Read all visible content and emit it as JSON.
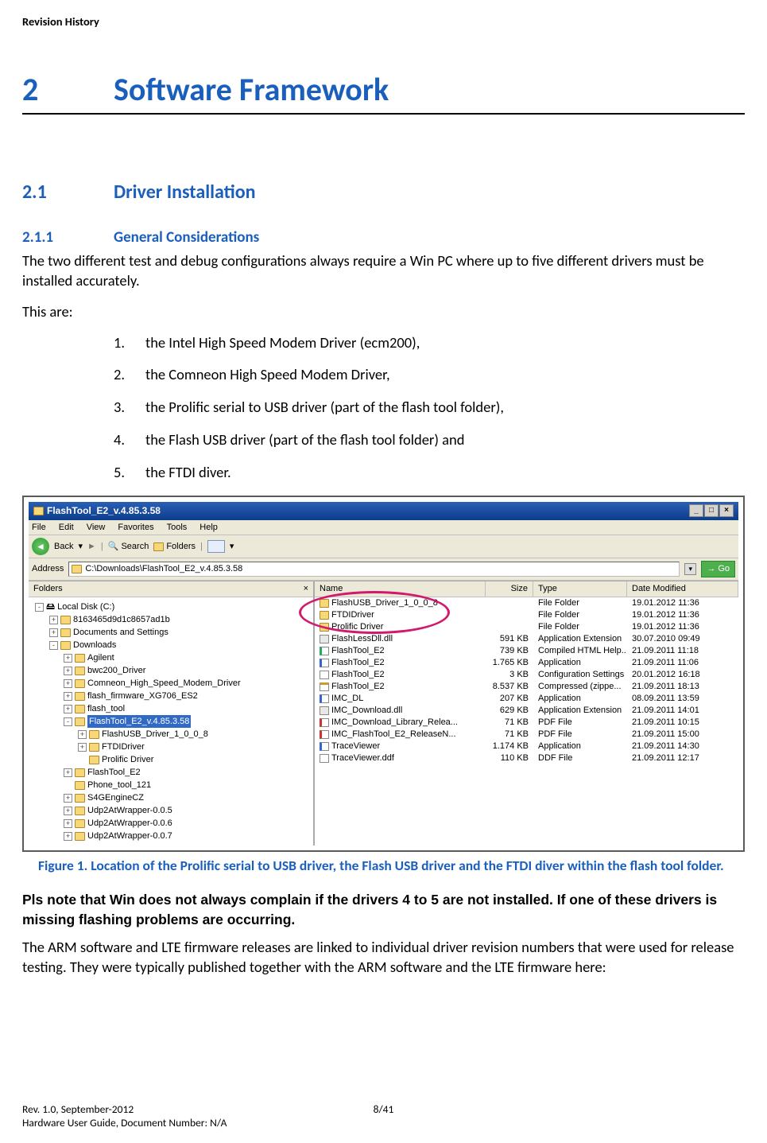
{
  "header": "Revision History",
  "chapter": {
    "num": "2",
    "title": "Software Framework"
  },
  "section": {
    "num": "2.1",
    "title": "Driver Installation"
  },
  "subsection": {
    "num": "2.1.1",
    "title": "General Considerations"
  },
  "para1": "The two different test and debug configurations always require a Win PC where up to five different drivers must be installed accurately.",
  "para2": "This are:",
  "drivers": [
    "the Intel High Speed Modem Driver (ecm200),",
    "the Comneon High Speed Modem Driver,",
    "the Prolific serial to USB driver (part of the flash tool folder),",
    "the Flash USB driver (part of the flash tool folder) and",
    "the FTDI diver."
  ],
  "explorer": {
    "title": "FlashTool_E2_v.4.85.3.58",
    "menu": [
      "File",
      "Edit",
      "View",
      "Favorites",
      "Tools",
      "Help"
    ],
    "toolbar": {
      "back": "Back",
      "search": "Search",
      "folders": "Folders"
    },
    "address_label": "Address",
    "address_path": "C:\\Downloads\\FlashTool_E2_v.4.85.3.58",
    "go": "Go",
    "folders_pane_title": "Folders",
    "tree": {
      "root": "Local Disk (C:)",
      "items": [
        {
          "level": 1,
          "exp": "+",
          "label": "8163465d9d1c8657ad1b"
        },
        {
          "level": 1,
          "exp": "+",
          "label": "Documents and Settings"
        },
        {
          "level": 1,
          "exp": "-",
          "label": "Downloads"
        },
        {
          "level": 2,
          "exp": "+",
          "label": "Agilent"
        },
        {
          "level": 2,
          "exp": "+",
          "label": "bwc200_Driver"
        },
        {
          "level": 2,
          "exp": "+",
          "label": "Comneon_High_Speed_Modem_Driver"
        },
        {
          "level": 2,
          "exp": "+",
          "label": "flash_firmware_XG706_ES2"
        },
        {
          "level": 2,
          "exp": "+",
          "label": "flash_tool"
        },
        {
          "level": 2,
          "exp": "-",
          "label": "FlashTool_E2_v.4.85.3.58",
          "selected": true
        },
        {
          "level": 3,
          "exp": "+",
          "label": "FlashUSB_Driver_1_0_0_8"
        },
        {
          "level": 3,
          "exp": "+",
          "label": "FTDIDriver"
        },
        {
          "level": 3,
          "exp": "",
          "label": "Prolific Driver"
        },
        {
          "level": 2,
          "exp": "+",
          "label": "FlashTool_E2"
        },
        {
          "level": 2,
          "exp": "",
          "label": "Phone_tool_121"
        },
        {
          "level": 2,
          "exp": "+",
          "label": "S4GEngineCZ"
        },
        {
          "level": 2,
          "exp": "+",
          "label": "Udp2AtWrapper-0.0.5"
        },
        {
          "level": 2,
          "exp": "+",
          "label": "Udp2AtWrapper-0.0.6"
        },
        {
          "level": 2,
          "exp": "+",
          "label": "Udp2AtWrapper-0.0.7"
        }
      ]
    },
    "columns": {
      "name": "Name",
      "size": "Size",
      "type": "Type",
      "date": "Date Modified"
    },
    "files": [
      {
        "icon": "folder",
        "name": "FlashUSB_Driver_1_0_0_8",
        "size": "",
        "type": "File Folder",
        "date": "19.01.2012 11:36"
      },
      {
        "icon": "folder",
        "name": "FTDIDriver",
        "size": "",
        "type": "File Folder",
        "date": "19.01.2012 11:36"
      },
      {
        "icon": "folder",
        "name": "Prolific Driver",
        "size": "",
        "type": "File Folder",
        "date": "19.01.2012 11:36"
      },
      {
        "icon": "dll",
        "name": "FlashLessDll.dll",
        "size": "591 KB",
        "type": "Application Extension",
        "date": "30.07.2010 09:49"
      },
      {
        "icon": "chm",
        "name": "FlashTool_E2",
        "size": "739 KB",
        "type": "Compiled HTML Help...",
        "date": "21.09.2011 11:18"
      },
      {
        "icon": "exe",
        "name": "FlashTool_E2",
        "size": "1.765 KB",
        "type": "Application",
        "date": "21.09.2011 11:06"
      },
      {
        "icon": "ini",
        "name": "FlashTool_E2",
        "size": "3 KB",
        "type": "Configuration Settings",
        "date": "20.01.2012 16:18"
      },
      {
        "icon": "zip",
        "name": "FlashTool_E2",
        "size": "8.537 KB",
        "type": "Compressed (zippe...",
        "date": "21.09.2011 18:13"
      },
      {
        "icon": "exe",
        "name": "IMC_DL",
        "size": "207 KB",
        "type": "Application",
        "date": "08.09.2011 13:59"
      },
      {
        "icon": "dll",
        "name": "IMC_Download.dll",
        "size": "629 KB",
        "type": "Application Extension",
        "date": "21.09.2011 14:01"
      },
      {
        "icon": "pdf",
        "name": "IMC_Download_Library_Relea...",
        "size": "71 KB",
        "type": "PDF File",
        "date": "21.09.2011 10:15"
      },
      {
        "icon": "pdf",
        "name": "IMC_FlashTool_E2_ReleaseN...",
        "size": "71 KB",
        "type": "PDF File",
        "date": "21.09.2011 15:00"
      },
      {
        "icon": "exe",
        "name": "TraceViewer",
        "size": "1.174 KB",
        "type": "Application",
        "date": "21.09.2011 14:30"
      },
      {
        "icon": "ddf",
        "name": "TraceViewer.ddf",
        "size": "110 KB",
        "type": "DDF File",
        "date": "21.09.2011 12:17"
      }
    ]
  },
  "figure_caption": "Figure 1. Location of the Prolific serial to USB driver, the Flash USB driver and the FTDI diver within the flash tool folder.",
  "bold_note": "Pls note that Win does not always complain if the drivers 4 to 5 are not installed. If one of these drivers is missing flashing problems are occurring.",
  "para3": "The ARM software and LTE firmware releases are linked to individual driver revision numbers that were used for release testing. They were typically published together with the ARM software and the LTE firmware here:",
  "footer": {
    "line1": "Rev. 1.0, September-2012",
    "line2": "Hardware User Guide, Document Number: N/A",
    "page": "8/41"
  }
}
